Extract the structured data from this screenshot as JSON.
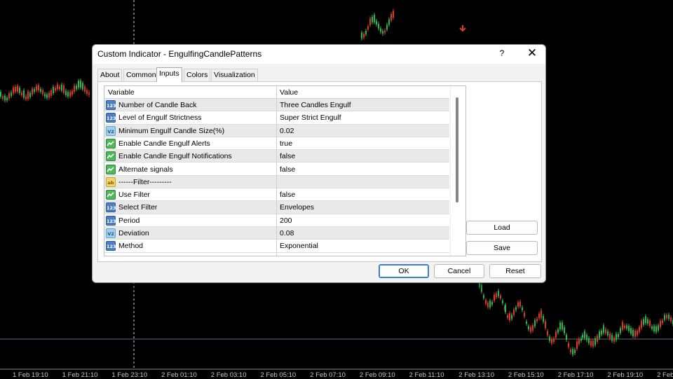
{
  "background_chart": {
    "time_labels": [
      "1 Feb 19:10",
      "1 Feb 21:10",
      "1 Feb 23:10",
      "2 Feb 01:10",
      "2 Feb 03:10",
      "2 Feb 05:10",
      "2 Feb 07:10",
      "2 Feb 09:10",
      "2 Feb 11:10",
      "2 Feb 13:10",
      "2 Feb 15:10",
      "2 Feb 17:10",
      "2 Feb 19:10",
      "2 Feb"
    ],
    "colors": {
      "bull": "#2db84b",
      "bear": "#e03a1e",
      "grid": "#5a6a7a",
      "background": "#000000"
    }
  },
  "dialog": {
    "title": "Custom Indicator - EngulfingCandlePatterns",
    "help": "?",
    "close_icon": "close-icon",
    "tabs": [
      {
        "label": "About",
        "active": false
      },
      {
        "label": "Common",
        "active": false
      },
      {
        "label": "Inputs",
        "active": true
      },
      {
        "label": "Colors",
        "active": false
      },
      {
        "label": "Visualization",
        "active": false
      }
    ],
    "grid": {
      "headers": {
        "variable": "Variable",
        "value": "Value"
      },
      "rows": [
        {
          "type": "int",
          "icon_text": "123",
          "variable": "Number of Candle Back",
          "value": "Three Candles Engulf"
        },
        {
          "type": "int",
          "icon_text": "123",
          "variable": "Level of Engulf Strictness",
          "value": "Super Strict Engulf"
        },
        {
          "type": "double",
          "icon_text": "V2",
          "variable": "Minimum Engulf Candle Size(%)",
          "value": "0.02"
        },
        {
          "type": "bool",
          "icon_text": "",
          "variable": "Enable Candle Engulf Alerts",
          "value": "true"
        },
        {
          "type": "bool",
          "icon_text": "",
          "variable": "Enable Candle Engulf Notifications",
          "value": "false"
        },
        {
          "type": "bool",
          "icon_text": "",
          "variable": "Alternate signals",
          "value": "false"
        },
        {
          "type": "string",
          "icon_text": "ab",
          "variable": "------Filter---------",
          "value": ""
        },
        {
          "type": "bool",
          "icon_text": "",
          "variable": "Use Filter",
          "value": "false"
        },
        {
          "type": "int",
          "icon_text": "123",
          "variable": "Select Filter",
          "value": "Envelopes"
        },
        {
          "type": "int",
          "icon_text": "123",
          "variable": "Period",
          "value": "200"
        },
        {
          "type": "double",
          "icon_text": "V2",
          "variable": "Deviation",
          "value": "0.08"
        },
        {
          "type": "int",
          "icon_text": "123",
          "variable": "Method",
          "value": "Exponential"
        }
      ]
    },
    "side_buttons": {
      "load": "Load",
      "save": "Save"
    },
    "footer": {
      "ok": "OK",
      "cancel": "Cancel",
      "reset": "Reset"
    }
  }
}
